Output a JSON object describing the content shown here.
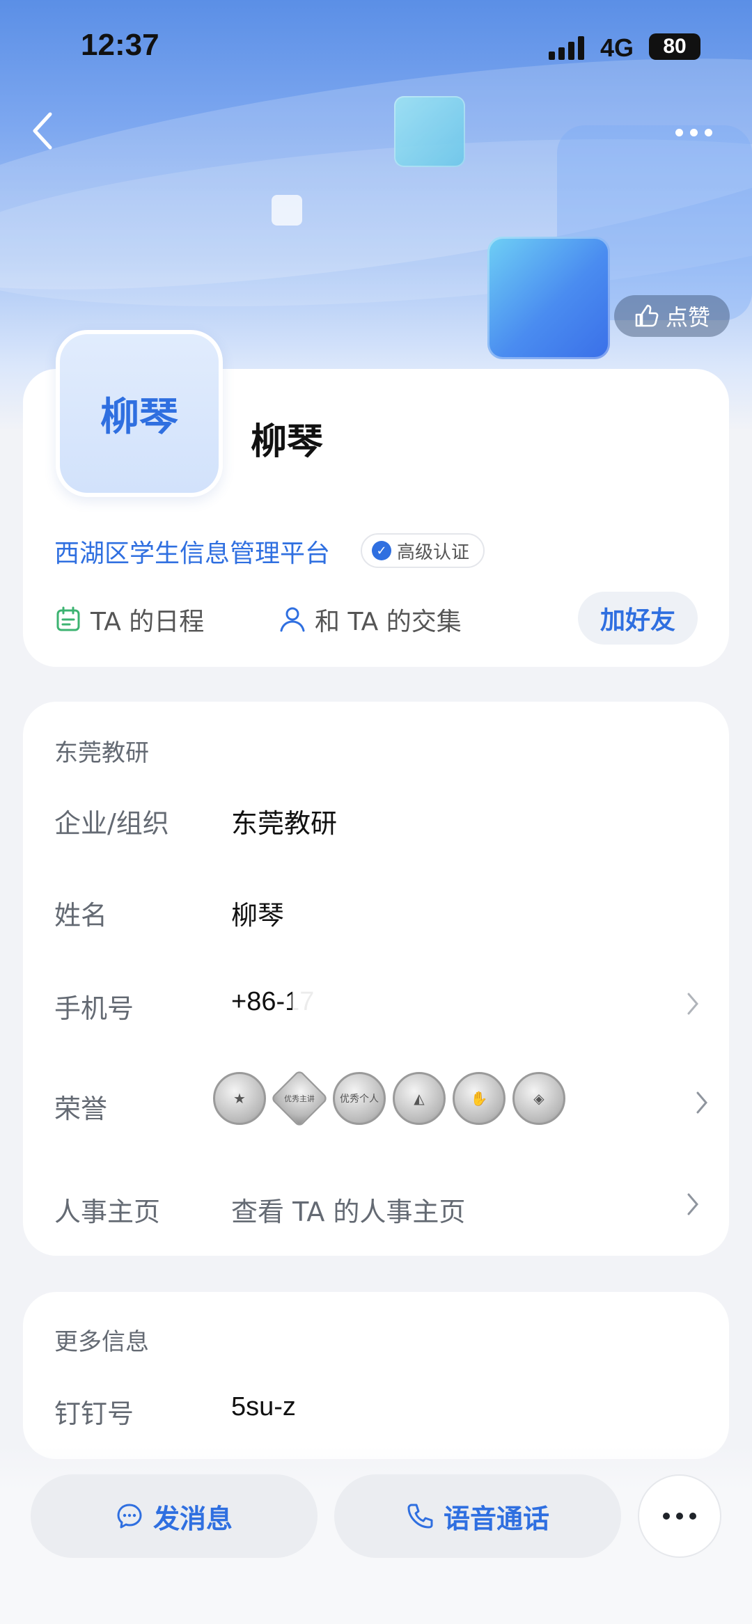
{
  "status_bar": {
    "time": "12:37",
    "network": "4G",
    "battery": "80"
  },
  "header": {
    "like_label": "点赞"
  },
  "profile": {
    "avatar_text": "柳琴",
    "name": "柳琴",
    "org_link": "西湖区学生信息管理平台",
    "cert_label": "高级认证",
    "actions": {
      "schedule_label": "TA 的日程",
      "intersection_label": "和 TA 的交集",
      "add_friend_label": "加好友"
    }
  },
  "info_card": {
    "section_title": "东莞教研",
    "rows": [
      {
        "label": "企业/组织",
        "value": "东莞教研"
      },
      {
        "label": "姓名",
        "value": "柳琴"
      },
      {
        "label": "手机号",
        "value": "+86-17"
      },
      {
        "label": "荣誉",
        "value": ""
      },
      {
        "label": "人事主页",
        "value": "查看 TA 的人事主页"
      }
    ],
    "badges": [
      "badge-1",
      "badge-2",
      "badge-3",
      "badge-4",
      "badge-5",
      "badge-6"
    ],
    "badge_labels": [
      "优秀主讲",
      "优秀个人"
    ]
  },
  "more_card": {
    "section_title": "更多信息",
    "rows": [
      {
        "label": "钉钉号",
        "value": "5su-z"
      }
    ]
  },
  "bottom_bar": {
    "message_label": "发消息",
    "call_label": "语音通话"
  },
  "colors": {
    "accent": "#2f6fe0",
    "card_bg": "#ffffff",
    "page_bg": "#f2f3f7"
  }
}
